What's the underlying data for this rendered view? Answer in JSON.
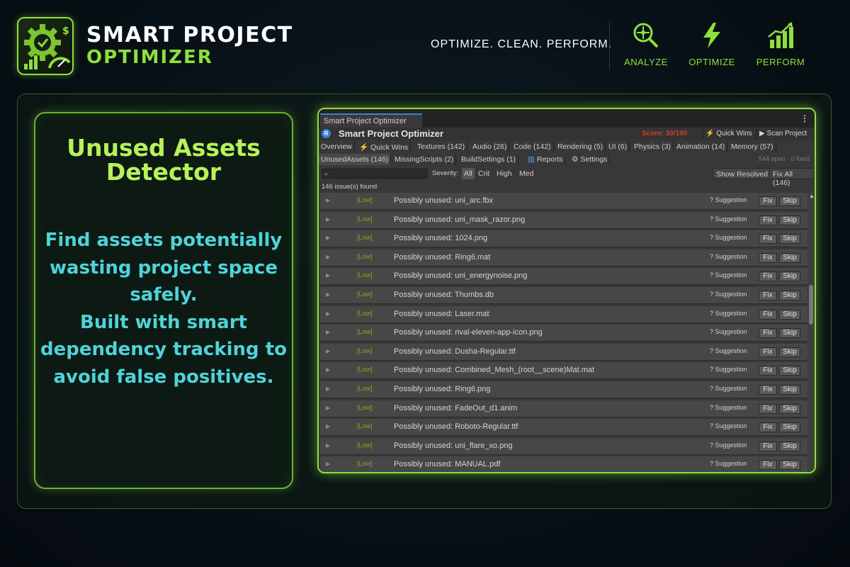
{
  "brand": {
    "line1": "SMART PROJECT",
    "line2": "OPTIMIZER"
  },
  "tagline": "OPTIMIZE. CLEAN. PERFORM.",
  "features": [
    {
      "label": "ANALYZE",
      "icon": "magnifier-target-icon"
    },
    {
      "label": "OPTIMIZE",
      "icon": "lightning-icon"
    },
    {
      "label": "PERFORM",
      "icon": "bar-chart-growth-icon"
    }
  ],
  "card": {
    "title": "Unused Assets Detector",
    "description": "Find assets potentially\nwasting project space\nsafely.\nBuilt with smart\ndependency tracking to\navoid false positives."
  },
  "editor": {
    "window_tab": "Smart Project Optimizer",
    "app_title": "Smart Project Optimizer",
    "score": "Score: 30/100",
    "quick_wins": "Quick Wins",
    "scan": "Scan Project",
    "tabs_row1": [
      "Overview",
      "Quick Wins",
      "Textures (142)",
      "Audio (26)",
      "Code (142)",
      "Rendering (5)",
      "UI (6)",
      "Physics (3)",
      "Animation (14)",
      "Memory (57)"
    ],
    "tabs_row2": [
      "UnusedAssets (146)",
      "MissingScripts (2)",
      "BuildSettings (1)",
      "Reports",
      "Settings"
    ],
    "open_fixed": "544 open · 0 fixed",
    "severity_label": "Severity:",
    "severity": [
      "All",
      "Crit",
      "High",
      "Med"
    ],
    "show_resolved": "Show Resolved",
    "fix_all": "Fix All (146)",
    "issue_count": "146 issue(s) found",
    "severity_tag": "[Low]",
    "suggestion": "? Suggestion",
    "fix": "Fix",
    "skip": "Skip",
    "issues": [
      "Possibly unused: uni_arc.fbx",
      "Possibly unused: uni_mask_razor.png",
      "Possibly unused: 1024.png",
      "Possibly unused: Ring6.mat",
      "Possibly unused: uni_energynoise.png",
      "Possibly unused: Thumbs.db",
      "Possibly unused: Laser.mat",
      "Possibly unused: rival-eleven-app-icon.png",
      "Possibly unused: Dusha-Regular.ttf",
      "Possibly unused: Combined_Mesh_(root__scene)Mat.mat",
      "Possibly unused: Ring6.png",
      "Possibly unused: FadeOut_d1.anim",
      "Possibly unused: Roboto-Regular.ttf",
      "Possibly unused: uni_flare_xo.png",
      "Possibly unused: MANUAL.pdf"
    ]
  },
  "colors": {
    "accent_green": "#8ee03a",
    "title_green": "#b6f25a",
    "cyan": "#4fd3d8",
    "score_red": "#d83a2a",
    "low_tag": "#8aa620"
  }
}
